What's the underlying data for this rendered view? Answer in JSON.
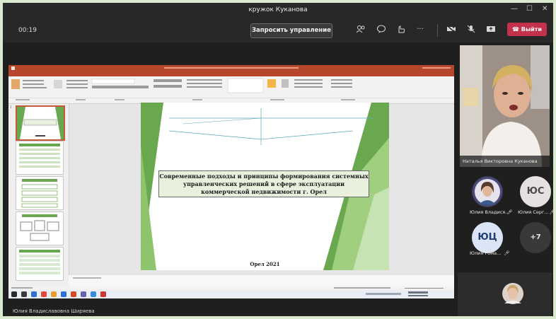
{
  "window": {
    "title": "кружок Куканова",
    "minimize": "—",
    "maximize": "☐",
    "close": "✕"
  },
  "toolbar": {
    "timer": "00:19",
    "request_control": "Запросить управление",
    "more": "···",
    "leave": "Выйти",
    "leave_color": "#c4314b"
  },
  "slide": {
    "title": "Современные подходы и принципы формирования системных управленческих решений в сфере эксплуатации коммерческой недвижимости г. Орел",
    "footer": "Орел 2021",
    "accent": "#6aa84f"
  },
  "presenter": {
    "name": "Наталья Викторовна Куканова"
  },
  "participants": [
    {
      "initials": "",
      "name": "Юлия Владися..."
    },
    {
      "initials": "ЮС",
      "name": "Юлия Серг..."
    },
    {
      "initials": "ЮЦ",
      "name": "Юлия Рома..."
    },
    {
      "initials": "+7",
      "name": ""
    }
  ],
  "self": {
    "name": "Юлия Владиславовна Ширяева"
  }
}
